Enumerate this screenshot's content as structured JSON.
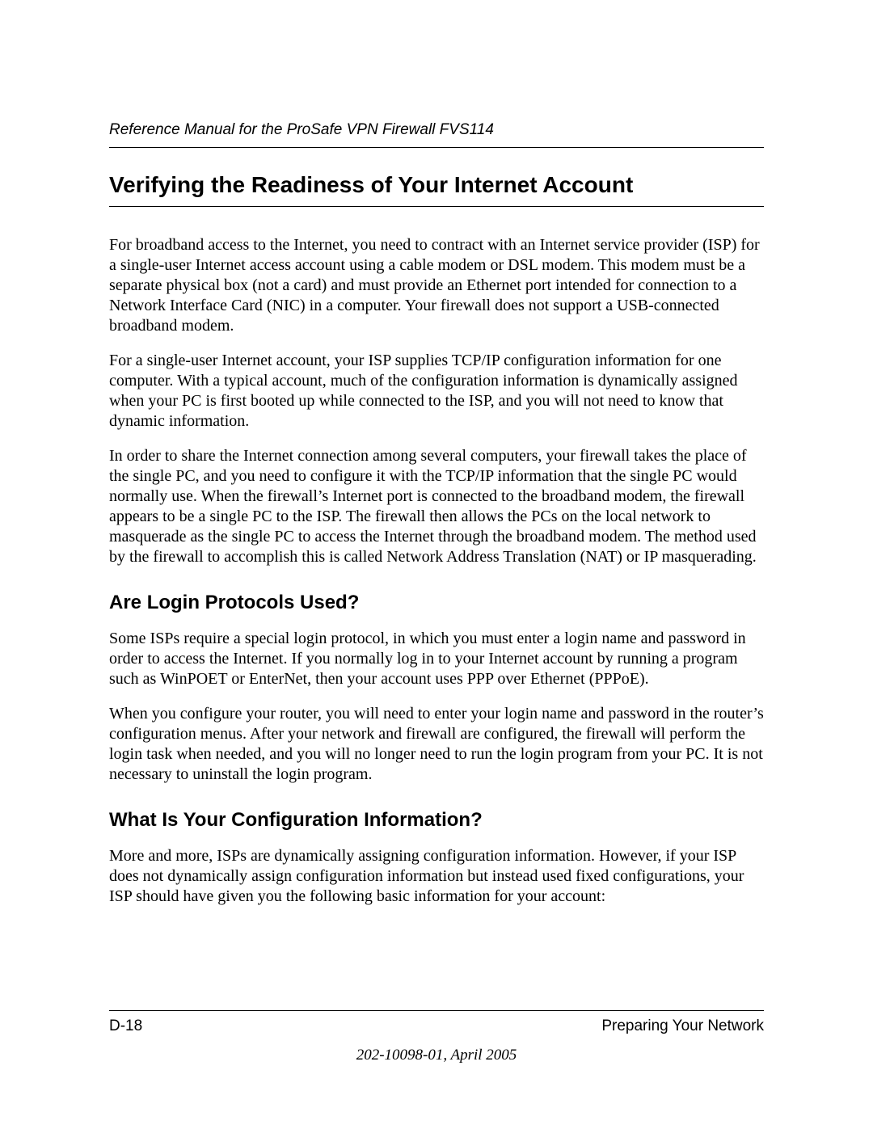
{
  "header": {
    "running_title": "Reference Manual for the ProSafe VPN Firewall FVS114"
  },
  "main": {
    "title": "Verifying the Readiness of Your Internet Account",
    "para1": "For broadband access to the Internet, you need to contract with an Internet service provider (ISP) for a single-user Internet access account using a cable modem or DSL modem. This modem must be a separate physical box (not a card) and must provide an Ethernet port intended for connection to a Network Interface Card (NIC) in a computer. Your firewall does not support a USB-connected broadband modem.",
    "para2": "For a single-user Internet account, your ISP supplies TCP/IP configuration information for one computer. With a typical account, much of the configuration information is dynamically assigned when your PC is first booted up while connected to the ISP, and you will not need to know that dynamic information.",
    "para3": "In order to share the Internet connection among several computers, your firewall takes the place of the single PC, and you need to configure it with the TCP/IP information that the single PC would normally use. When the firewall’s Internet port is connected to the broadband modem, the firewall appears to be a single PC to the ISP. The firewall then allows the PCs on the local network to masquerade as the single PC to access the Internet through the broadband modem. The method used by the firewall to accomplish this is called Network Address Translation (NAT) or IP masquerading.",
    "sub1_title": "Are Login Protocols Used?",
    "sub1_para1": "Some ISPs require a special login protocol, in which you must enter a login name and password in order to access the Internet. If you normally log in to your Internet account by running a program such as WinPOET or EnterNet, then your account uses PPP over Ethernet (PPPoE).",
    "sub1_para2": "When you configure your router, you will need to enter your login name and password in the router’s configuration menus. After your network and firewall are configured, the firewall will perform the login task when needed, and you will no longer need to run the login program from your PC. It is not necessary to uninstall the login program.",
    "sub2_title": "What Is Your Configuration Information?",
    "sub2_para1": "More and more, ISPs are dynamically assigning configuration information. However, if your ISP does not dynamically assign configuration information but instead used fixed configurations, your ISP should have given you the following basic information for your account:"
  },
  "footer": {
    "page_number": "D-18",
    "section_name": "Preparing Your Network",
    "doc_info": "202-10098-01, April 2005"
  }
}
